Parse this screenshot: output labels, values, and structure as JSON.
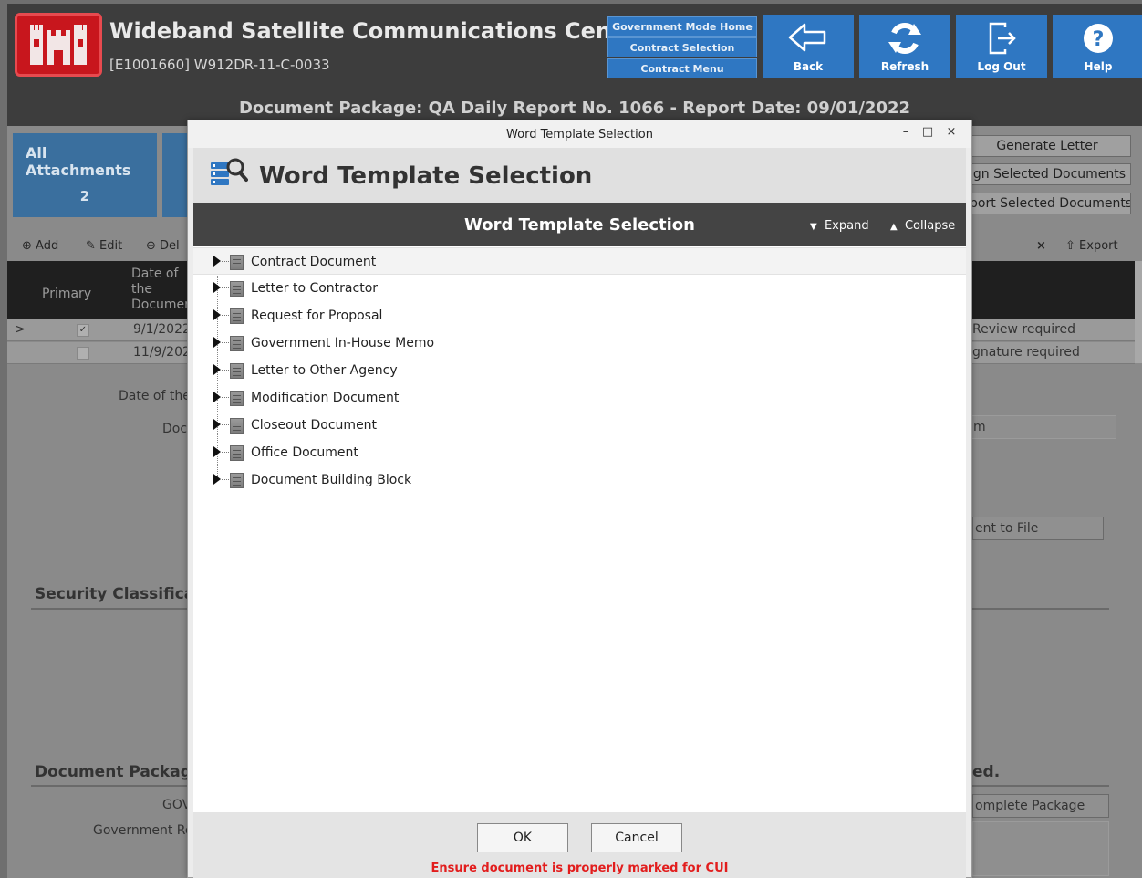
{
  "header": {
    "title": "Wideband Satellite Communications Center",
    "subtitle": "[E1001660] W912DR-11-C-0033",
    "nav_links": [
      "Government Mode Home",
      "Contract Selection",
      "Contract Menu"
    ],
    "buttons": {
      "back": "Back",
      "refresh": "Refresh",
      "logout": "Log Out",
      "help": "Help"
    }
  },
  "page": {
    "package_title": "Document Package: QA Daily Report No. 1066 - Report Date: 09/01/2022",
    "all_attachments_label": "All Attachments",
    "all_attachments_count": "2",
    "right_buttons": [
      "Generate Letter",
      "ign Selected Documents",
      "port Selected Documents"
    ],
    "toolbar": {
      "add": "Add",
      "edit": "Edit",
      "delete": "Del",
      "export": "Export",
      "clear": "×"
    },
    "table": {
      "col_primary": "Primary",
      "col_date": "Date of the Documen",
      "rows": [
        {
          "expander": ">",
          "date": "9/1/2022",
          "status": "Review required"
        },
        {
          "expander": "",
          "date": "11/9/202",
          "status": "gnature required"
        }
      ]
    },
    "labels": {
      "date_of_the": "Date of the",
      "doc": "Doc",
      "field_m": "m",
      "attach_to_file": "ent to File",
      "security_classification": "Security Classificati",
      "document_package": "Document Package",
      "gov": "GOV",
      "government_re": "Government Re",
      "ed": "ed.",
      "complete_package": "omplete Package"
    }
  },
  "dialog": {
    "window_title": "Word Template Selection",
    "heading": "Word Template Selection",
    "band_title": "Word Template Selection",
    "expand_label": "Expand",
    "collapse_label": "Collapse",
    "tree_items": [
      "Contract Document",
      "Letter to Contractor",
      "Request for Proposal",
      "Government In-House Memo",
      "Letter to Other Agency",
      "Modification Document",
      "Closeout Document",
      "Office Document",
      "Document Building Block"
    ],
    "ok_label": "OK",
    "cancel_label": "Cancel",
    "warning": "Ensure document is properly marked for CUI",
    "colors": {
      "band": "#444444",
      "warning": "#e21d1d",
      "accent": "#2f77c2"
    }
  }
}
